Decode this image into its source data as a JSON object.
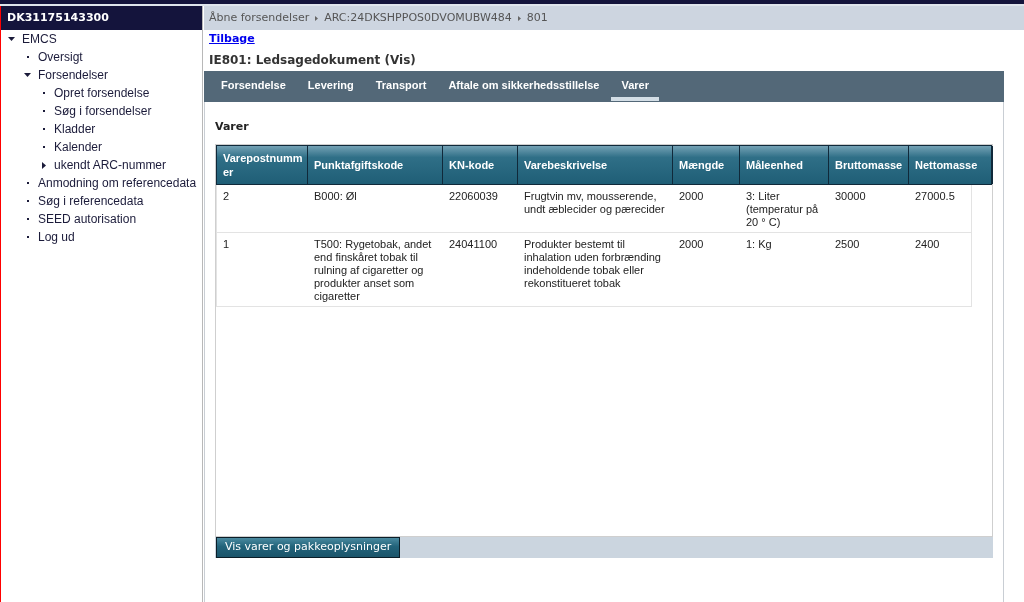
{
  "sidebar": {
    "header": "DK31175143300",
    "tree": [
      {
        "label": "EMCS",
        "kind": "branch",
        "expanded": true,
        "children": [
          {
            "label": "Oversigt",
            "kind": "leaf"
          },
          {
            "label": "Forsendelser",
            "kind": "branch",
            "expanded": true,
            "children": [
              {
                "label": "Opret forsendelse",
                "kind": "leaf"
              },
              {
                "label": "Søg i forsendelser",
                "kind": "leaf"
              },
              {
                "label": "Kladder",
                "kind": "leaf"
              },
              {
                "label": "Kalender",
                "kind": "leaf"
              },
              {
                "label": "ukendt ARC-nummer",
                "kind": "branch",
                "expanded": false
              }
            ]
          },
          {
            "label": "Anmodning om referencedata",
            "kind": "leaf"
          },
          {
            "label": "Søg i referencedata",
            "kind": "leaf"
          },
          {
            "label": "SEED autorisation",
            "kind": "leaf"
          },
          {
            "label": "Log ud",
            "kind": "leaf"
          }
        ]
      }
    ]
  },
  "breadcrumb": [
    "Åbne forsendelser",
    "ARC:24DKSHPPOS0DVOMUBW484",
    "801"
  ],
  "back_link": "Tilbage",
  "page_title": "IE801: Ledsagedokument (Vis)",
  "tabs": [
    {
      "label": "Forsendelse",
      "selected": false
    },
    {
      "label": "Levering",
      "selected": false
    },
    {
      "label": "Transport",
      "selected": false
    },
    {
      "label": "Aftale om sikkerhedsstillelse",
      "selected": false
    },
    {
      "label": "Varer",
      "selected": true
    }
  ],
  "section": {
    "title": "Varer",
    "table": {
      "columns": [
        "Varepostnummer",
        "Punktafgiftskode",
        "KN-kode",
        "Varebeskrivelse",
        "Mængde",
        "Måleenhed",
        "Bruttomasse",
        "Nettomasse"
      ],
      "rows": [
        [
          "2",
          "B000: Øl",
          "22060039",
          "Frugtvin mv, mousserende, undt æblecider og pærecider",
          "2000",
          "3: Liter (temperatur på 20 ° C)",
          "30000",
          "27000.5"
        ],
        [
          "1",
          "T500: Rygetobak, andet end finskåret tobak til rulning af cigaretter og produkter anset som cigaretter",
          "24041100",
          "Produkter bestemt til inhalation uden forbrænding indeholdende tobak eller rekonstitueret tobak",
          "2000",
          "1: Kg",
          "2500",
          "2400"
        ]
      ]
    }
  },
  "button": "Vis varer og pakkeoplysninger"
}
